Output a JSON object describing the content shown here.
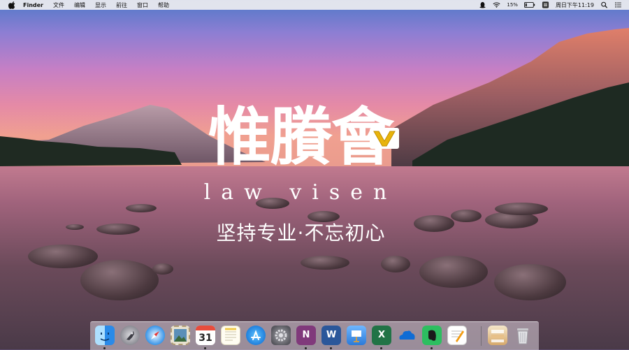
{
  "menubar": {
    "app_name": "Finder",
    "items": [
      "文件",
      "编辑",
      "显示",
      "前往",
      "窗口",
      "帮助"
    ],
    "battery_percent": "15%",
    "clock": "周日下午11:19"
  },
  "logo": {
    "title": "惟賸會",
    "subtitle": "law visen",
    "slogan": "坚持专业·不忘初心"
  },
  "dock": {
    "apps": [
      "finder-icon",
      "launchpad-icon",
      "safari-icon",
      "photo-app-icon",
      "calendar-icon",
      "notes-icon",
      "app-store-icon",
      "system-preferences-icon",
      "onenote-icon",
      "word-icon",
      "keynote-icon",
      "excel-icon",
      "onedrive-icon",
      "evernote-icon",
      "pages-icon",
      "downloads-stack-icon",
      "trash-icon"
    ],
    "calendar_day": "31",
    "onenote_letter": "N",
    "word_letter": "W",
    "excel_letter": "X"
  },
  "colors": {
    "menubar_bg": "#ececf0",
    "logo_gold": "#e8b40c",
    "sky_top": "#4f79c8",
    "sky_glow": "#e58aa6"
  }
}
